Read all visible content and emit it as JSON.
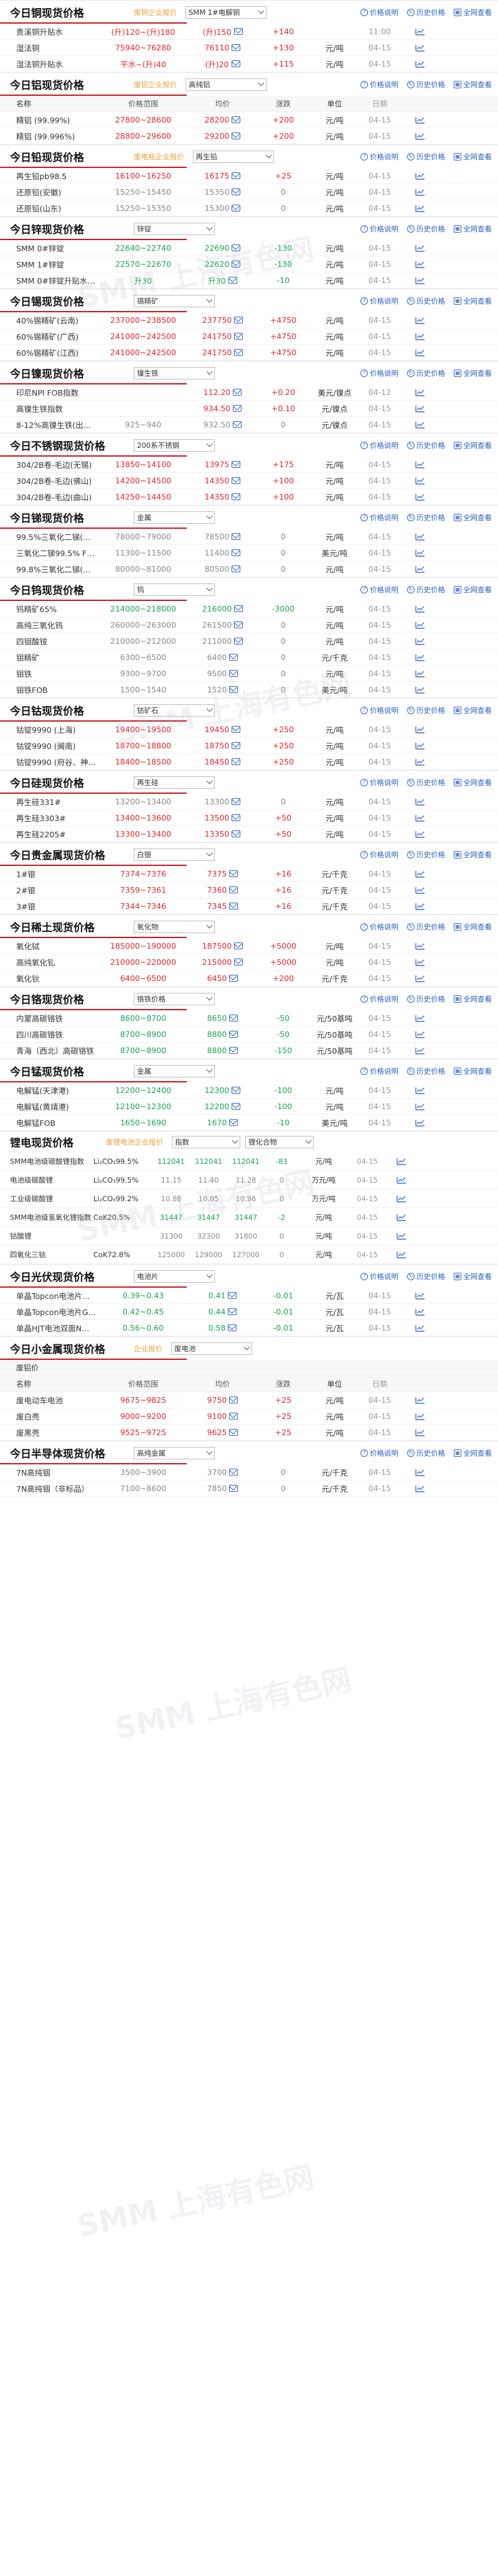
{
  "sections": [
    {
      "id": "copper",
      "title": "今日铜现货价格",
      "subtitle": "废铜企业报价",
      "select": "SMM 1#电解铜",
      "links": [
        "价格说明",
        "历史价格",
        "全网查看"
      ],
      "rows": [
        {
          "name": "贵溪铜升贴水",
          "range": "(升)120~(升)180",
          "avg": "(升)150",
          "chg": "+140",
          "cls": "red",
          "unit": "",
          "date": "11:00"
        },
        {
          "name": "湿法铜",
          "range": "75940~76280",
          "avg": "76110",
          "chg": "+130",
          "cls": "red",
          "unit": "元/吨",
          "date": "04-15"
        },
        {
          "name": "湿法铜升贴水",
          "range": "平水~(升)40",
          "avg": "(升)20",
          "chg": "+115",
          "cls": "red",
          "unit": "元/吨",
          "date": "04-15"
        }
      ]
    },
    {
      "id": "aluminum",
      "title": "今日铝现货价格",
      "subtitle": "废铝企业报价",
      "select": "高纯铝",
      "links": [
        "价格说明",
        "历史价格",
        "全网查看"
      ],
      "colhdr": true,
      "rows": [
        {
          "name": "精铝 (99.99%)",
          "range": "27800~28600",
          "avg": "28200",
          "chg": "+200",
          "cls": "red",
          "unit": "元/吨",
          "date": "04-15"
        },
        {
          "name": "精铝 (99.996%)",
          "range": "28800~29600",
          "avg": "29200",
          "chg": "+200",
          "cls": "red",
          "unit": "元/吨",
          "date": "04-15"
        }
      ]
    },
    {
      "id": "lead",
      "title": "今日铅现货价格",
      "subtitle": "废电瓶企业报价",
      "select": "再生铅",
      "links": [
        "价格说明",
        "历史价格",
        "全网查看"
      ],
      "rows": [
        {
          "name": "再生铅pb98.5",
          "range": "16100~16250",
          "avg": "16175",
          "chg": "+25",
          "cls": "red",
          "unit": "元/吨",
          "date": "04-15"
        },
        {
          "name": "还原铅(安徽)",
          "range": "15250~15450",
          "avg": "15350",
          "chg": "0",
          "cls": "gray",
          "unit": "元/吨",
          "date": "04-15"
        },
        {
          "name": "还原铅(山东)",
          "range": "15250~15350",
          "avg": "15300",
          "chg": "0",
          "cls": "gray",
          "unit": "元/吨",
          "date": "04-15"
        }
      ]
    },
    {
      "id": "zinc",
      "title": "今日锌现货价格",
      "subtitle": "",
      "select": "锌锭",
      "links": [
        "价格说明",
        "历史价格",
        "全网查看"
      ],
      "rows": [
        {
          "name": "SMM 0#锌锭",
          "range": "22640~22740",
          "avg": "22690",
          "chg": "-130",
          "cls": "green",
          "unit": "元/吨",
          "date": "04-15"
        },
        {
          "name": "SMM 1#锌锭",
          "range": "22570~22670",
          "avg": "22620",
          "chg": "-130",
          "cls": "green",
          "unit": "元/吨",
          "date": "04-15"
        },
        {
          "name": "SMM 0#锌锭升贴水（广东）",
          "range": "升30",
          "avg": "升30",
          "chg": "-10",
          "cls": "green",
          "unit": "元/吨",
          "date": "04-15"
        }
      ]
    },
    {
      "id": "tin",
      "title": "今日锡现货价格",
      "subtitle": "",
      "select": "锡精矿",
      "links": [
        "价格说明",
        "历史价格",
        "全网查看"
      ],
      "rows": [
        {
          "name": "40%锡精矿(云南)",
          "range": "237000~238500",
          "avg": "237750",
          "chg": "+4750",
          "cls": "red",
          "unit": "元/吨",
          "date": "04-15"
        },
        {
          "name": "60%锡精矿(广西)",
          "range": "241000~242500",
          "avg": "241750",
          "chg": "+4750",
          "cls": "red",
          "unit": "元/吨",
          "date": "04-15"
        },
        {
          "name": "60%锡精矿(江西)",
          "range": "241000~242500",
          "avg": "241750",
          "chg": "+4750",
          "cls": "red",
          "unit": "元/吨",
          "date": "04-15"
        }
      ]
    },
    {
      "id": "nickel",
      "title": "今日镍现货价格",
      "subtitle": "",
      "select": "镍生铁",
      "links": [
        "价格说明",
        "历史价格",
        "全网查看"
      ],
      "rows": [
        {
          "name": "印尼NPI FOB指数",
          "range": "",
          "avg": "112.20",
          "chg": "+0.20",
          "cls": "red",
          "unit": "美元/镍点",
          "date": "04-12"
        },
        {
          "name": "高镍生铁指数",
          "range": "",
          "avg": "934.50",
          "chg": "+0.10",
          "cls": "red",
          "unit": "元/镍点",
          "date": "04-15"
        },
        {
          "name": "8-12%高镍生铁(出厂价)",
          "range": "925~940",
          "avg": "932.50",
          "chg": "0",
          "cls": "gray",
          "unit": "元/镍点",
          "date": "04-15"
        }
      ]
    },
    {
      "id": "steel",
      "title": "今日不锈钢现货价格",
      "subtitle": "",
      "select": "200系不锈钢",
      "links": [
        "价格说明",
        "历史价格",
        "全网查看"
      ],
      "rows": [
        {
          "name": "304/2B卷-毛边(无锡)",
          "range": "13850~14100",
          "avg": "13975",
          "chg": "+175",
          "cls": "red",
          "unit": "元/吨",
          "date": "04-15"
        },
        {
          "name": "304/2B卷-毛边(佛山)",
          "range": "14200~14500",
          "avg": "14350",
          "chg": "+100",
          "cls": "red",
          "unit": "元/吨",
          "date": "04-15"
        },
        {
          "name": "304/2B卷-毛边(曲山)",
          "range": "14250~14450",
          "avg": "14350",
          "chg": "+100",
          "cls": "red",
          "unit": "元/吨",
          "date": "04-15"
        }
      ]
    },
    {
      "id": "antimony",
      "title": "今日锑现货价格",
      "subtitle": "",
      "select": "金属",
      "links": [
        "价格说明",
        "历史价格",
        "全网查看"
      ],
      "rows": [
        {
          "name": "99.5%三氧化二锑(国产)",
          "range": "78000~79000",
          "avg": "78500",
          "chg": "0",
          "cls": "gray",
          "unit": "元/吨",
          "date": "04-15"
        },
        {
          "name": "三氧化二锑99.5% FOB",
          "range": "11300~11500",
          "avg": "11400",
          "chg": "0",
          "cls": "gray",
          "unit": "美元/吨",
          "date": "04-15"
        },
        {
          "name": "99.8%三氧化二锑(国产)",
          "range": "80000~81000",
          "avg": "80500",
          "chg": "0",
          "cls": "gray",
          "unit": "元/吨",
          "date": "04-15"
        }
      ]
    },
    {
      "id": "tungsten",
      "title": "今日钨现货价格",
      "subtitle": "",
      "select": "钨",
      "links": [
        "价格说明",
        "历史价格",
        "全网查看"
      ],
      "rows": [
        {
          "name": "钨精矿65%",
          "range": "214000~218000",
          "avg": "216000",
          "chg": "-3000",
          "cls": "green",
          "unit": "元/吨",
          "date": "04-15"
        },
        {
          "name": "高纯三氧化钨",
          "range": "260000~263000",
          "avg": "261500",
          "chg": "0",
          "cls": "gray",
          "unit": "元/吨",
          "date": "04-15"
        },
        {
          "name": "四钼酸铵",
          "range": "210000~212000",
          "avg": "211000",
          "chg": "0",
          "cls": "gray",
          "unit": "元/吨",
          "date": "04-15"
        },
        {
          "name": "钼精矿",
          "range": "6300~6500",
          "avg": "6400",
          "chg": "0",
          "cls": "gray",
          "unit": "元/千克",
          "date": "04-15"
        },
        {
          "name": "钼铁",
          "range": "9300~9700",
          "avg": "9500",
          "chg": "0",
          "cls": "gray",
          "unit": "元/吨",
          "date": "04-15"
        },
        {
          "name": "钼铁FOB",
          "range": "1500~1540",
          "avg": "1520",
          "chg": "0",
          "cls": "gray",
          "unit": "美元/吨",
          "date": "04-15"
        }
      ]
    },
    {
      "id": "cobalt",
      "title": "今日钴现货价格",
      "subtitle": "",
      "select": "钴矿石",
      "links": [
        "价格说明",
        "历史价格",
        "全网查看"
      ],
      "rows": [
        {
          "name": "钴锭9990 (上海)",
          "range": "19400~19500",
          "avg": "19450",
          "chg": "+250",
          "cls": "red",
          "unit": "元/吨",
          "date": "04-15"
        },
        {
          "name": "钴锭9990 (闽南)",
          "range": "18700~18800",
          "avg": "18750",
          "chg": "+250",
          "cls": "red",
          "unit": "元/吨",
          "date": "04-15"
        },
        {
          "name": "钴锭9990 (府谷、神木)",
          "range": "18400~18500",
          "avg": "18450",
          "chg": "+250",
          "cls": "red",
          "unit": "元/吨",
          "date": "04-15"
        }
      ]
    },
    {
      "id": "silicon",
      "title": "今日硅现货价格",
      "subtitle": "",
      "select": "再生硅",
      "links": [
        "价格说明",
        "历史价格",
        "全网查看"
      ],
      "rows": [
        {
          "name": "再生硅331#",
          "range": "13200~13400",
          "avg": "13300",
          "chg": "0",
          "cls": "gray",
          "unit": "元/吨",
          "date": "04-15"
        },
        {
          "name": "再生硅3303#",
          "range": "13400~13600",
          "avg": "13500",
          "chg": "+50",
          "cls": "red",
          "unit": "元/吨",
          "date": "04-15"
        },
        {
          "name": "再生硅2205#",
          "range": "13300~13400",
          "avg": "13350",
          "chg": "+50",
          "cls": "red",
          "unit": "元/吨",
          "date": "04-15"
        }
      ]
    },
    {
      "id": "precious",
      "title": "今日贵金属现货价格",
      "subtitle": "",
      "select": "白银",
      "links": [
        "价格说明",
        "历史价格",
        "全网查看"
      ],
      "rows": [
        {
          "name": "1#银",
          "range": "7374~7376",
          "avg": "7375",
          "chg": "+16",
          "cls": "red",
          "unit": "元/千克",
          "date": "04-15"
        },
        {
          "name": "2#银",
          "range": "7359~7361",
          "avg": "7360",
          "chg": "+16",
          "cls": "red",
          "unit": "元/千克",
          "date": "04-15"
        },
        {
          "name": "3#银",
          "range": "7344~7346",
          "avg": "7345",
          "chg": "+16",
          "cls": "red",
          "unit": "元/千克",
          "date": "04-15"
        }
      ]
    },
    {
      "id": "rare",
      "title": "今日稀土现货价格",
      "subtitle": "",
      "select": "氧化物",
      "links": [
        "价格说明",
        "历史价格",
        "全网查看"
      ],
      "rows": [
        {
          "name": "氧化铽",
          "range": "185000~190000",
          "avg": "187500",
          "chg": "+5000",
          "cls": "red",
          "unit": "元/吨",
          "date": "04-15"
        },
        {
          "name": "高纯氧化钆",
          "range": "210000~220000",
          "avg": "215000",
          "chg": "+5000",
          "cls": "red",
          "unit": "元/吨",
          "date": "04-15"
        },
        {
          "name": "氧化钬",
          "range": "6400~6500",
          "avg": "6450",
          "chg": "+200",
          "cls": "red",
          "unit": "元/千克",
          "date": "04-15"
        }
      ]
    },
    {
      "id": "ferro",
      "title": "今日铬现货价格",
      "subtitle": "",
      "select": "铬铁价格",
      "links": [
        "价格说明",
        "历史价格",
        "全网查看"
      ],
      "rows": [
        {
          "name": "内蒙高碳铬铁",
          "range": "8600~8700",
          "avg": "8650",
          "chg": "-50",
          "cls": "green",
          "unit": "元/50基吨",
          "date": "04-15"
        },
        {
          "name": "四川高碳铬铁",
          "range": "8700~8900",
          "avg": "8800",
          "chg": "-50",
          "cls": "green",
          "unit": "元/50基吨",
          "date": "04-15"
        },
        {
          "name": "青海（西北）高碳铬铁",
          "range": "8700~8900",
          "avg": "8800",
          "chg": "-150",
          "cls": "green",
          "unit": "元/50基吨",
          "date": "04-15"
        }
      ]
    },
    {
      "id": "manganese",
      "title": "今日锰现货价格",
      "subtitle": "",
      "select": "金属",
      "links": [
        "价格说明",
        "历史价格",
        "全网查看"
      ],
      "rows": [
        {
          "name": "电解锰(天津港)",
          "range": "12200~12400",
          "avg": "12300",
          "chg": "-100",
          "cls": "green",
          "unit": "元/吨",
          "date": "04-15"
        },
        {
          "name": "电解锰(黄靖港)",
          "range": "12100~12300",
          "avg": "12200",
          "chg": "-100",
          "cls": "green",
          "unit": "元/吨",
          "date": "04-15"
        },
        {
          "name": "电解锰FOB",
          "range": "1650~1690",
          "avg": "1670",
          "chg": "-10",
          "cls": "green",
          "unit": "美元/吨",
          "date": "04-15"
        }
      ]
    }
  ],
  "battery": {
    "title": "锂电现货价格",
    "subtitle": "废锂电池企业报价",
    "select1": "指数",
    "select2": "锂化合物",
    "rows": [
      {
        "name": "SMM电池级碳酸锂指数",
        "code": "Li₂CO₃99.5%",
        "v1": "112041",
        "v2": "112041",
        "v3": "112041",
        "chg": "-83",
        "cls": "green",
        "unit": "元/吨",
        "date": "04-15"
      },
      {
        "name": "电池级碳酸锂",
        "code": "Li₂CO₃99.5%",
        "v1": "11.15",
        "v2": "11.40",
        "v3": "11.28",
        "chg": "0",
        "cls": "gray",
        "unit": "万元/吨",
        "date": "04-15"
      },
      {
        "name": "工业级碳酸锂",
        "code": "Li₂CO₃99.2%",
        "v1": "10.88",
        "v2": "10.85",
        "v3": "10.96",
        "chg": "0",
        "cls": "gray",
        "unit": "万元/吨",
        "date": "04-15"
      },
      {
        "name": "SMM电池级氢氧化锂指数",
        "code": "CoK20.5%",
        "v1": "31447",
        "v2": "31447",
        "v3": "31447",
        "chg": "-2",
        "cls": "green",
        "unit": "元/吨",
        "date": "04-15"
      },
      {
        "name": "钴酸锂",
        "code": "",
        "v1": "31300",
        "v2": "32300",
        "v3": "31800",
        "chg": "0",
        "cls": "gray",
        "unit": "元/吨",
        "date": "04-15"
      },
      {
        "name": "四氧化三钴",
        "code": "CoK72.8%",
        "v1": "125000",
        "v2": "129000",
        "v3": "127000",
        "chg": "0",
        "cls": "gray",
        "unit": "元/吨",
        "date": "04-15"
      }
    ]
  },
  "pv": {
    "title": "今日光伏现货价格",
    "select": "电池片",
    "links": [
      "价格说明",
      "历史价格",
      "全网查看"
    ],
    "rows": [
      {
        "name": "单晶Topcon电池片M10",
        "range": "0.39~0.43",
        "avg": "0.41",
        "chg": "-0.01",
        "cls": "green",
        "unit": "元/瓦",
        "date": "04-15"
      },
      {
        "name": "单晶Topcon电池片G12",
        "range": "0.42~0.45",
        "avg": "0.44",
        "chg": "-0.01",
        "cls": "green",
        "unit": "元/瓦",
        "date": "04-15"
      },
      {
        "name": "单晶HJT电池双面N型-G12半片",
        "range": "0.56~0.60",
        "avg": "0.58",
        "chg": "-0.01",
        "cls": "green",
        "unit": "元/瓦",
        "date": "04-15"
      }
    ]
  },
  "minor": {
    "title": "今日小金属现货价格",
    "subtitle": "企业报价",
    "select": "废电池",
    "colhdr2": "废铝价",
    "rows": [
      {
        "name": "废电动车电池",
        "range": "9675~9825",
        "avg": "9750",
        "chg": "+25",
        "cls": "red",
        "unit": "元/吨",
        "date": "04-15"
      },
      {
        "name": "废白壳",
        "range": "9000~9200",
        "avg": "9100",
        "chg": "+25",
        "cls": "red",
        "unit": "元/吨",
        "date": "04-15"
      },
      {
        "name": "废黑壳",
        "range": "9525~9725",
        "avg": "9625",
        "chg": "+25",
        "cls": "red",
        "unit": "元/吨",
        "date": "04-15"
      }
    ]
  },
  "semi": {
    "title": "今日半导体现货价格",
    "select": "高纯金属",
    "links": [
      "价格说明",
      "历史价格",
      "全网查看"
    ],
    "rows": [
      {
        "name": "7N高纯铟",
        "range": "3500~3900",
        "avg": "3700",
        "chg": "0",
        "cls": "gray",
        "unit": "元/千克",
        "date": "04-15"
      },
      {
        "name": "7N高纯铟（非标品）",
        "range": "7100~8600",
        "avg": "7850",
        "chg": "0",
        "cls": "gray",
        "unit": "元/千克",
        "date": "04-15"
      }
    ]
  },
  "colhdr": {
    "name": "名称",
    "range": "价格范围",
    "avg": "均价",
    "chg": "涨跌",
    "unit": "单位",
    "date": "日期"
  },
  "watermark": "SMM 上海有色网"
}
